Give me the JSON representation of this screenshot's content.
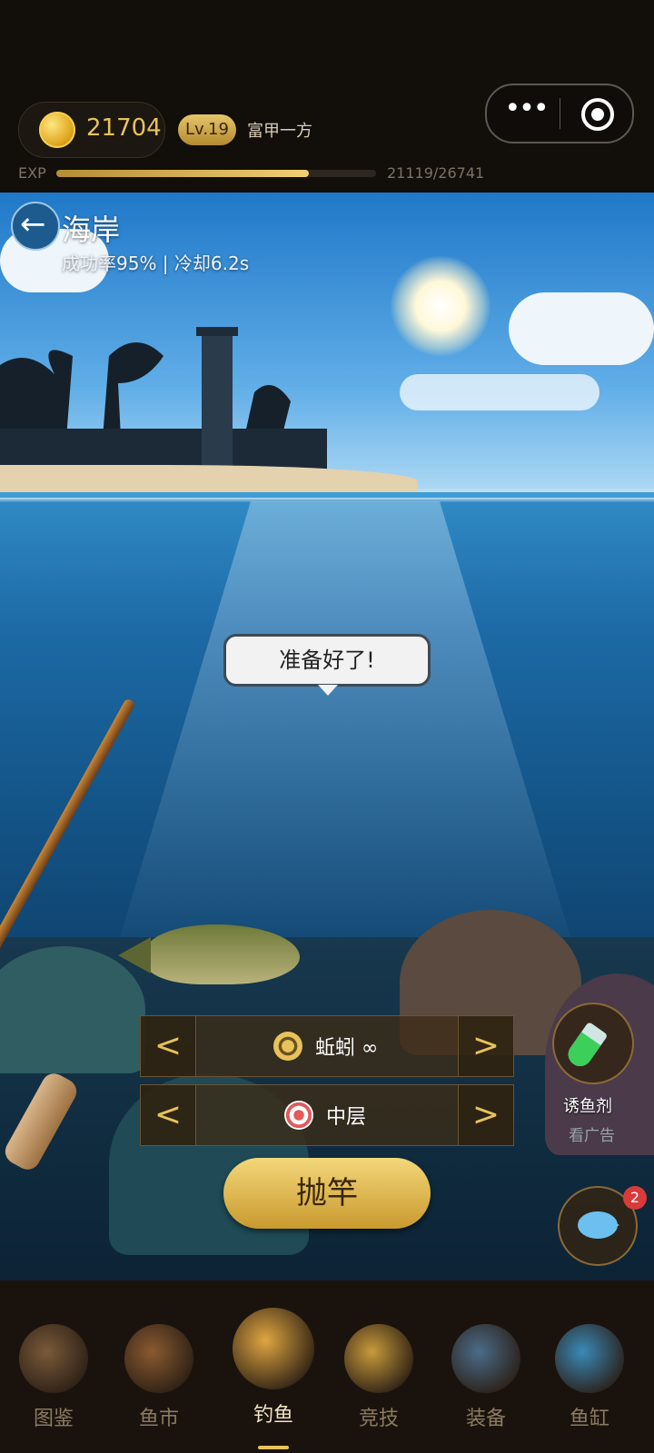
{
  "status": {
    "coins": "21704",
    "level": "Lv.19",
    "title": "富甲一方",
    "exp_label": "EXP",
    "exp_text": "21119/26741",
    "exp_progress": 0.79
  },
  "capsule": {
    "more_icon": "more-dots-icon",
    "close_icon": "target-close-icon"
  },
  "location": {
    "name": "海岸",
    "stats": "成功率95% | 冷却6.2s"
  },
  "bubble": {
    "text": "准备好了!"
  },
  "bait": {
    "label": "蚯蚓 ∞",
    "icon": "worm-bait-icon"
  },
  "depth": {
    "label": "中层",
    "icon": "depth-target-icon"
  },
  "arrows": {
    "left": "<",
    "right": ">"
  },
  "cast_button": "抛竿",
  "lure": {
    "label": "诱鱼剂",
    "sub": "看广告",
    "icon": "potion-tube-icon"
  },
  "tank_button": {
    "badge": "2",
    "icon": "fish-icon"
  },
  "nav": {
    "items": [
      {
        "label": "图鉴",
        "icon": "book-icon",
        "color": "#7a5a3a"
      },
      {
        "label": "鱼市",
        "icon": "market-stall-icon",
        "color": "#8a5a30"
      },
      {
        "label": "钓鱼",
        "icon": "golden-fish-icon",
        "color": "#e0a640"
      },
      {
        "label": "竞技",
        "icon": "trophy-icon",
        "color": "#c89a3a"
      },
      {
        "label": "装备",
        "icon": "fishing-reel-icon",
        "color": "#4a6c8a"
      },
      {
        "label": "鱼缸",
        "icon": "fishbowl-icon",
        "color": "#3a8ab8"
      }
    ],
    "active_index": 2
  },
  "colors": {
    "gold": "#e8c25a",
    "nav_bg": "#1a130d",
    "badge_red": "#d93a3a"
  }
}
